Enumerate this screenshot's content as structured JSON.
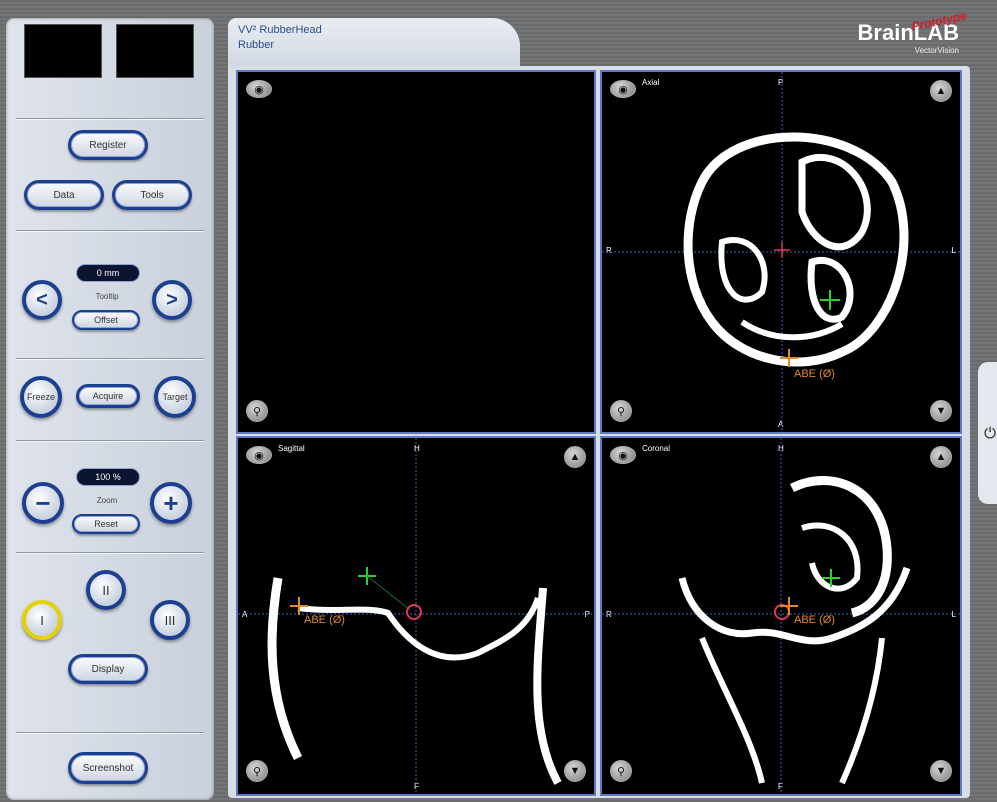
{
  "header": {
    "patient_line1": "VV² RubberHead",
    "patient_line2": "Rubber",
    "brand": "BrainLAB",
    "brand_sub": "VectorVision",
    "prototype": "Prototype"
  },
  "left_panel": {
    "register": "Register",
    "data": "Data",
    "tools": "Tools",
    "tooltip_value": "0 mm",
    "tooltip_label": "Tooltip",
    "offset": "Offset",
    "freeze": "Freeze",
    "acquire": "Acquire",
    "target": "Target",
    "zoom_value": "100 %",
    "zoom_label": "Zoom",
    "reset": "Reset",
    "layout_1": "I",
    "layout_2": "II",
    "layout_3": "III",
    "display": "Display",
    "screenshot": "Screenshot"
  },
  "views": {
    "axial": {
      "label": "Axial",
      "top": "P",
      "bottom": "A",
      "left": "R",
      "right": "L",
      "point": "ABE (Ø)"
    },
    "sagittal": {
      "label": "Sagittal",
      "top": "H",
      "bottom": "F",
      "left": "A",
      "right": "P",
      "point": "ABE (Ø)"
    },
    "coronal": {
      "label": "Coronal",
      "top": "H",
      "bottom": "F",
      "left": "R",
      "right": "L",
      "point": "ABE (Ø)"
    }
  },
  "icons": {
    "eye": "eye-icon",
    "zoom": "magnifier-icon",
    "up": "arrow-up-icon",
    "down": "arrow-down-icon",
    "power": "power-icon"
  },
  "colors": {
    "accent": "#1d3f8f",
    "crosshair_green": "#2bd12b",
    "marker_orange": "#e08a2a",
    "marker_pink": "#e0355a"
  }
}
